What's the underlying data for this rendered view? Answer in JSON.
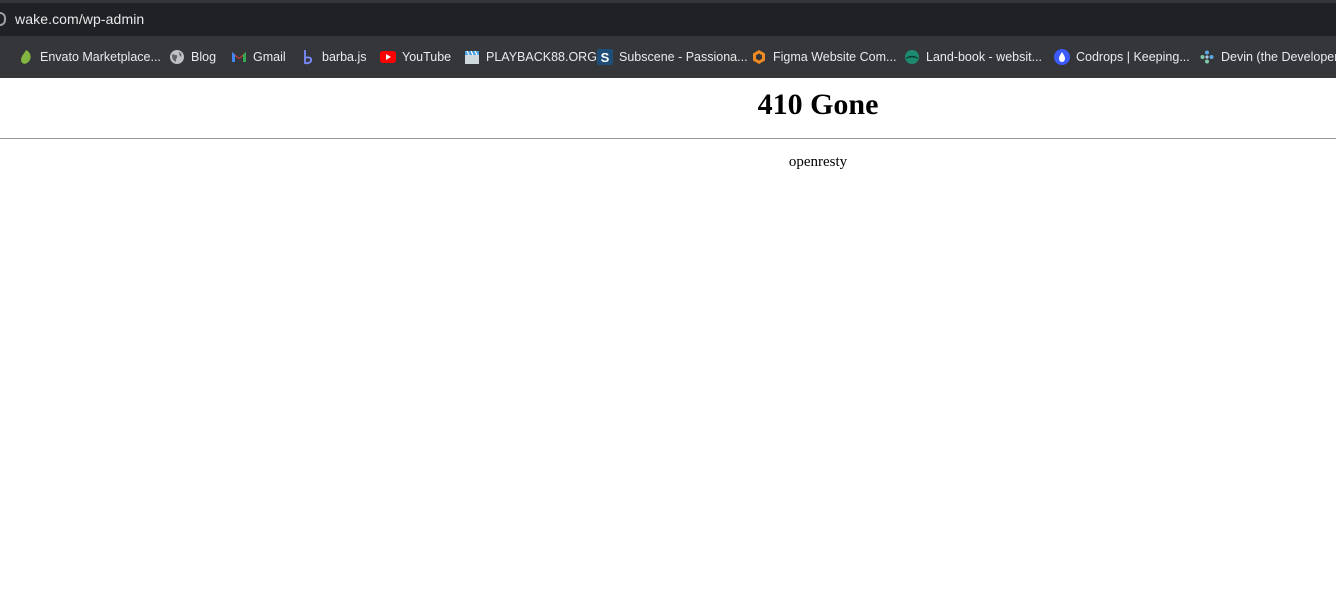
{
  "browser": {
    "address_bar": {
      "url": "wake.com/wp-admin"
    },
    "bookmarks": [
      {
        "label": "Envato Marketplace...",
        "icon": "leaf-icon",
        "color": "#82b541"
      },
      {
        "label": "Blog",
        "icon": "globe-icon",
        "color": "#bdc1c6"
      },
      {
        "label": "Gmail",
        "icon": "gmail-icon",
        "color": "#ea4335"
      },
      {
        "label": "barba.js",
        "icon": "barba-icon",
        "color": "#7b8cff"
      },
      {
        "label": "YouTube",
        "icon": "youtube-icon",
        "color": "#ff0000"
      },
      {
        "label": "PLAYBACK88.ORG",
        "icon": "clapperboard-icon",
        "color": "#4aa3df"
      },
      {
        "label": "Subscene - Passiona...",
        "icon": "subscene-s-icon",
        "color": "#1f4e79"
      },
      {
        "label": "Figma Website Com...",
        "icon": "hexagon-icon",
        "color": "#f08a24"
      },
      {
        "label": "Land-book - websit...",
        "icon": "landbook-icon",
        "color": "#1e8a70"
      },
      {
        "label": "Codrops | Keeping...",
        "icon": "drop-icon",
        "color": "#3d5afe"
      },
      {
        "label": "Devin (the Developer)",
        "icon": "devin-icon",
        "color": "#5aa9e6"
      }
    ]
  },
  "page": {
    "heading": "410 Gone",
    "server": "openresty"
  }
}
